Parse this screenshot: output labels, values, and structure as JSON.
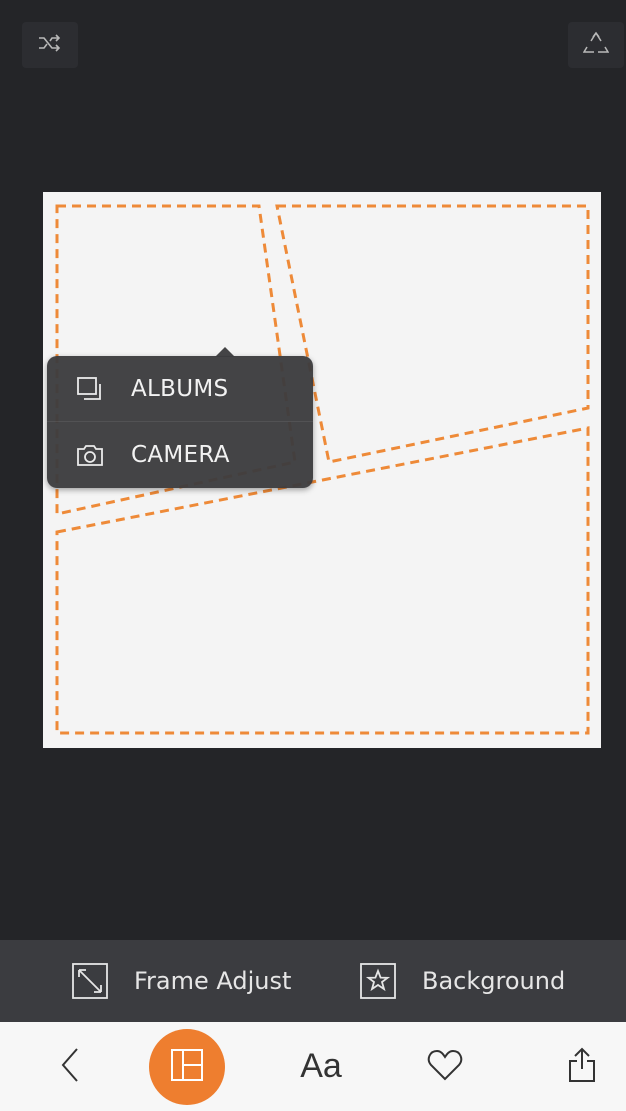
{
  "top_bar": {
    "shuffle_icon": "shuffle-icon",
    "recycle_icon": "recycle-icon"
  },
  "popup": {
    "items": [
      {
        "label": "ALBUMS",
        "icon": "albums-icon"
      },
      {
        "label": "CAMERA",
        "icon": "camera-icon"
      }
    ]
  },
  "options": {
    "frame_adjust_label": "Frame Adjust",
    "background_label": "Background"
  },
  "tabs": {
    "text_label": "Aa"
  },
  "colors": {
    "accent": "#ee7e2f",
    "dark_bg": "#242528",
    "canvas": "#f4f4f4"
  }
}
